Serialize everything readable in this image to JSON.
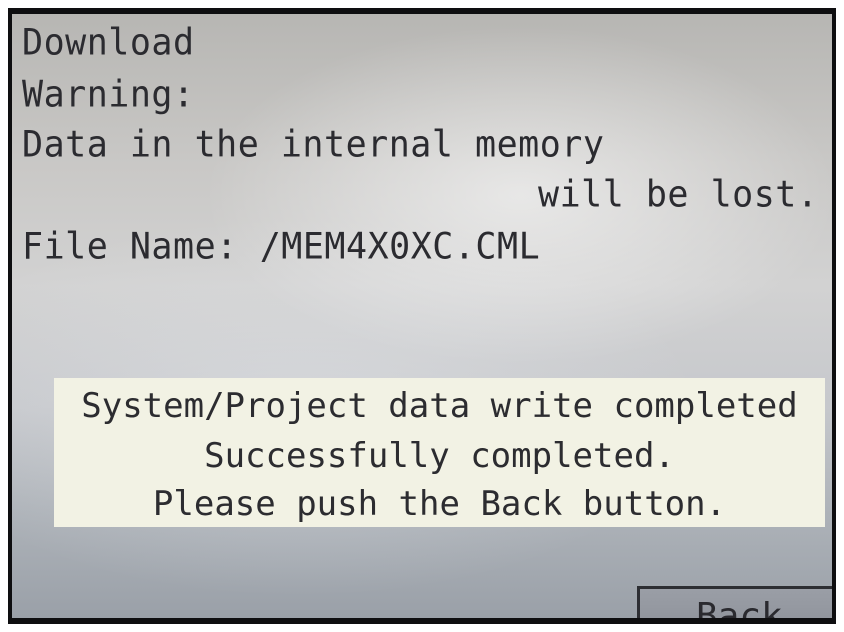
{
  "screen": {
    "title": "Download",
    "warning_label": "Warning:",
    "warning_line1": "Data in the internal memory",
    "warning_line2": "will be lost.",
    "file_label": "File Name:",
    "file_value": "/MEM4X0XC.CML"
  },
  "dialog": {
    "line1": "System/Project data write completed",
    "line2": "Successfully completed.",
    "line3": "Please push the Back button."
  },
  "back_button": {
    "label": "Back"
  },
  "colors": {
    "screen_background": "#c9c8c6",
    "dialog_background": "#f2f2e4",
    "text": "#2b2b30",
    "button": "#9a9ea6"
  }
}
